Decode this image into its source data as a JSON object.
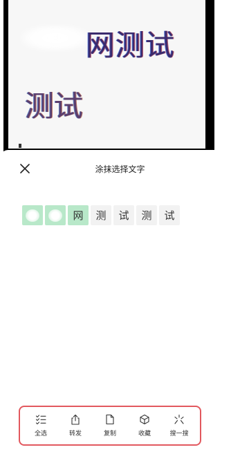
{
  "preview": {
    "line1": "网测试",
    "line2": "测试"
  },
  "sheet": {
    "title": "涂抹选择文字"
  },
  "chips": [
    {
      "text": "",
      "selected": true,
      "smudged": true
    },
    {
      "text": "",
      "selected": true,
      "smudged": true
    },
    {
      "text": "网",
      "selected": true,
      "smudged": false
    },
    {
      "text": "测",
      "selected": false,
      "smudged": false
    },
    {
      "text": "试",
      "selected": false,
      "smudged": false
    },
    {
      "text": "测",
      "selected": false,
      "smudged": false
    },
    {
      "text": "试",
      "selected": false,
      "smudged": false
    }
  ],
  "toolbar": {
    "select_all": "全选",
    "forward": "转发",
    "copy": "复制",
    "favorite": "收藏",
    "search": "搜一搜"
  },
  "colors": {
    "selected_chip": "#b8e8c9",
    "highlight_border": "#e2585e"
  },
  "icons": {
    "close": "close-icon",
    "select_all": "checklist-icon",
    "forward": "share-icon",
    "copy": "document-icon",
    "favorite": "cube-icon",
    "search": "sparkle-search-icon"
  }
}
